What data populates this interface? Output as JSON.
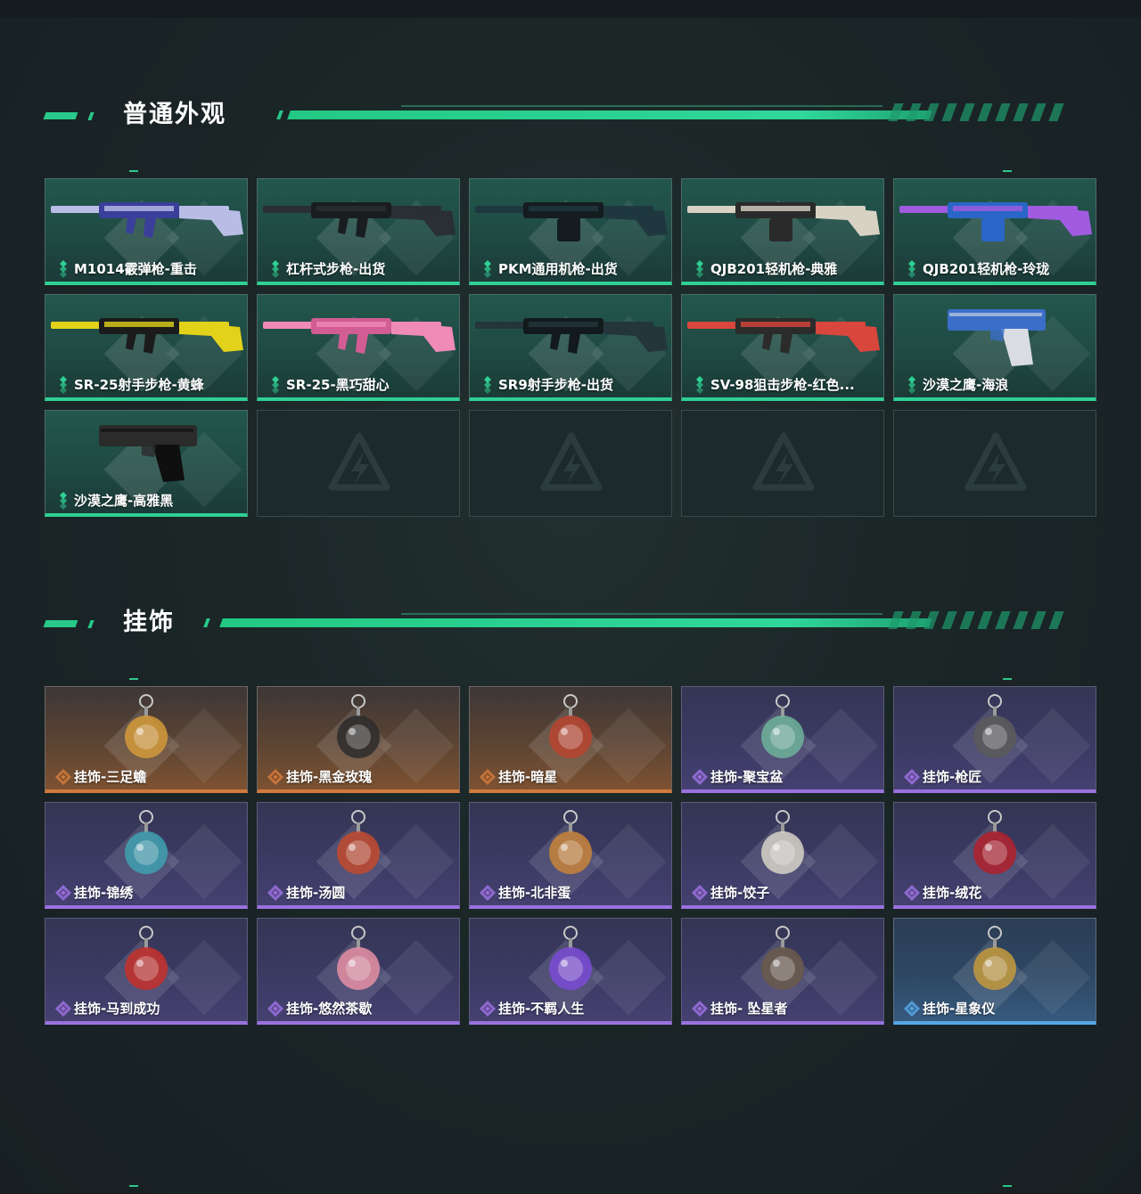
{
  "sections": {
    "skins": {
      "title": "普通外观",
      "items": [
        {
          "label": "M1014霰弹枪-重击",
          "icon": "shotgun-icon"
        },
        {
          "label": "杠杆式步枪-出货",
          "icon": "lever-rifle-icon"
        },
        {
          "label": "PKM通用机枪-出货",
          "icon": "machine-gun-icon"
        },
        {
          "label": "QJB201轻机枪-典雅",
          "icon": "light-machine-gun-icon"
        },
        {
          "label": "QJB201轻机枪-玲珑",
          "icon": "light-machine-gun-icon"
        },
        {
          "label": "SR-25射手步枪-黄蜂",
          "icon": "marksman-rifle-icon"
        },
        {
          "label": "SR-25-黑巧甜心",
          "icon": "marksman-rifle-icon"
        },
        {
          "label": "SR9射手步枪-出货",
          "icon": "marksman-rifle-icon"
        },
        {
          "label": "SV-98狙击步枪-红色...",
          "icon": "sniper-rifle-icon"
        },
        {
          "label": "沙漠之鹰-海浪",
          "icon": "pistol-icon"
        },
        {
          "label": "沙漠之鹰-高雅黑",
          "icon": "pistol-icon"
        }
      ]
    },
    "charms": {
      "title": "挂饰",
      "items": [
        {
          "label": "挂饰-三足蟾",
          "rarity": "orange",
          "icon": "toad-charm-icon"
        },
        {
          "label": "挂饰-黑金玫瑰",
          "rarity": "orange",
          "icon": "rose-charm-icon"
        },
        {
          "label": "挂饰-暗星",
          "rarity": "orange",
          "icon": "dark-star-charm-icon"
        },
        {
          "label": "挂饰-聚宝盆",
          "rarity": "purple",
          "icon": "treasure-bowl-charm-icon"
        },
        {
          "label": "挂饰-枪匠",
          "rarity": "purple",
          "icon": "gunsmith-charm-icon"
        },
        {
          "label": "挂饰-锦绣",
          "rarity": "purple",
          "icon": "butterfly-charm-icon"
        },
        {
          "label": "挂饰-汤圆",
          "rarity": "purple",
          "icon": "dumpling-bowl-charm-icon"
        },
        {
          "label": "挂饰-北非蛋",
          "rarity": "purple",
          "icon": "shakshuka-charm-icon"
        },
        {
          "label": "挂饰-饺子",
          "rarity": "purple",
          "icon": "dumpling-plate-charm-icon"
        },
        {
          "label": "挂饰-绒花",
          "rarity": "purple",
          "icon": "velvet-flower-charm-icon"
        },
        {
          "label": "挂饰-马到成功",
          "rarity": "purple",
          "icon": "horse-charm-icon"
        },
        {
          "label": "挂饰-悠然茶歇",
          "rarity": "purple",
          "icon": "cupcake-charm-icon"
        },
        {
          "label": "挂饰-不羁人生",
          "rarity": "purple",
          "icon": "sneaker-charm-icon"
        },
        {
          "label": "挂饰- 坠星者",
          "rarity": "purple",
          "icon": "star-pendant-charm-icon"
        },
        {
          "label": "挂饰-星象仪",
          "rarity": "blue",
          "icon": "astrolabe-charm-icon"
        }
      ]
    }
  },
  "colors": {
    "accent": "#27c889",
    "orange": "#d07a3d",
    "purple": "#9a72e0",
    "blue": "#58a7e6"
  }
}
